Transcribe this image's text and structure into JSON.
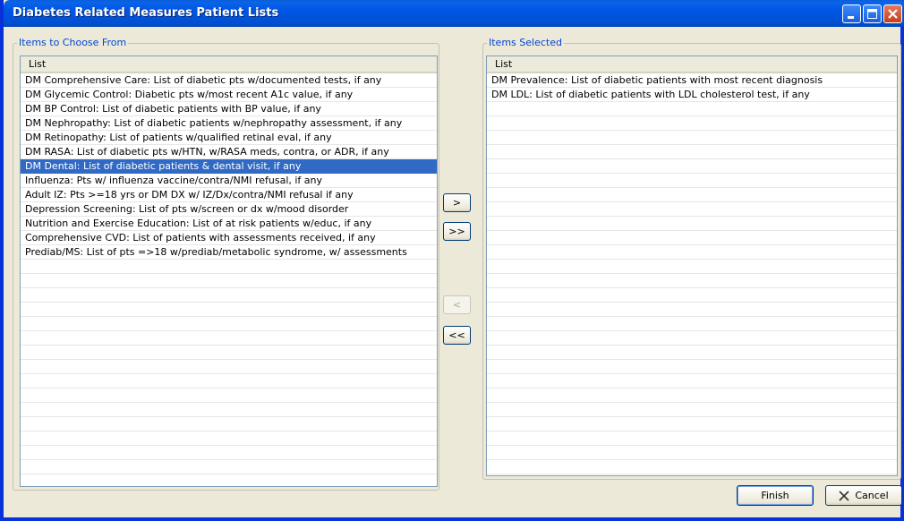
{
  "window": {
    "title": "Diabetes Related Measures Patient Lists"
  },
  "available": {
    "group_label": "Items to Choose From",
    "column_header": "List",
    "items": [
      "DM Comprehensive Care: List of diabetic pts w/documented tests, if any",
      "DM Glycemic Control: Diabetic pts w/most recent A1c value, if any",
      "DM BP Control: List of diabetic patients with BP value, if any",
      "DM Nephropathy: List of diabetic patients w/nephropathy assessment, if any",
      "DM Retinopathy: List of patients w/qualified retinal eval, if any",
      "DM RASA: List of diabetic pts w/HTN, w/RASA meds, contra, or ADR, if any",
      "DM Dental: List of diabetic patients & dental visit, if any",
      "Influenza: Pts w/ influenza vaccine/contra/NMI refusal, if any",
      "Adult IZ: Pts >=18 yrs or DM DX w/ IZ/Dx/contra/NMI refusal if any",
      "Depression Screening: List of pts w/screen or dx w/mood disorder",
      "Nutrition and Exercise Education: List of at risk patients w/educ, if any",
      "Comprehensive CVD: List of patients with assessments received, if any",
      "Prediab/MS: List of pts =>18 w/prediab/metabolic syndrome, w/ assessments"
    ],
    "selected_item": "DM Dental: List of diabetic patients & dental visit, if any"
  },
  "selected": {
    "group_label": "Items Selected",
    "column_header": "List",
    "items": [
      "DM Prevalence: List of diabetic patients with most recent diagnosis",
      "DM LDL: List of diabetic patients with LDL cholesterol test, if any"
    ]
  },
  "move_buttons": {
    "add_one": ">",
    "add_all": ">>",
    "remove_one": "<",
    "remove_all": "<<"
  },
  "buttons": {
    "finish": "Finish",
    "cancel": "Cancel"
  },
  "icons": {
    "minimize": "minimize-icon",
    "maximize": "maximize-icon",
    "close": "close-icon",
    "cancel": "x-icon"
  }
}
